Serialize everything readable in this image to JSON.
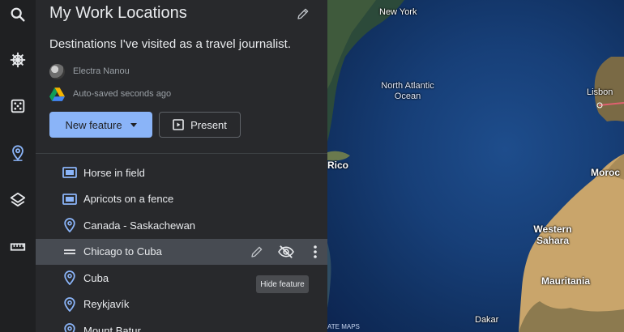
{
  "rail": {
    "items": [
      {
        "name": "search",
        "icon": "search-icon"
      },
      {
        "name": "voyager",
        "icon": "ship-wheel-icon"
      },
      {
        "name": "feeling-lucky",
        "icon": "dice-icon"
      },
      {
        "name": "projects",
        "icon": "map-pin-icon",
        "active": true
      },
      {
        "name": "map-style",
        "icon": "layers-icon"
      },
      {
        "name": "measure",
        "icon": "ruler-icon"
      }
    ]
  },
  "project": {
    "title": "My Work Locations",
    "description": "Destinations I've visited as a travel journalist.",
    "owner": "Electra Nanou",
    "save_status": "Auto-saved seconds ago"
  },
  "toolbar": {
    "new_feature_label": "New feature",
    "present_label": "Present"
  },
  "features": [
    {
      "label": "Horse in field",
      "icon": "slide-icon"
    },
    {
      "label": "Apricots on a fence",
      "icon": "slide-icon"
    },
    {
      "label": "Canada - Saskachewan",
      "icon": "placemark-icon"
    },
    {
      "label": "Chicago to Cuba",
      "icon": "line-icon",
      "selected": true
    },
    {
      "label": "Cuba",
      "icon": "placemark-icon"
    },
    {
      "label": "Reykjavík",
      "icon": "placemark-icon"
    },
    {
      "label": "Mount Batur",
      "icon": "placemark-icon"
    }
  ],
  "tooltip": "Hide feature",
  "map": {
    "labels": {
      "new_york": "New York",
      "ocean": "North Atlantic Ocean",
      "lisbon": "Lisbon",
      "rico": "Rico",
      "morocco": "Moroc",
      "western_sahara": "Western Sahara",
      "mauritania": "Mauritania",
      "dakar": "Dakar"
    },
    "attribution": "ATE MAPS"
  },
  "colors": {
    "accent": "#8ab4f8",
    "panel": "#28292c",
    "rail": "#1f2022",
    "selected_row": "#474b52",
    "route_line": "#e06070"
  }
}
